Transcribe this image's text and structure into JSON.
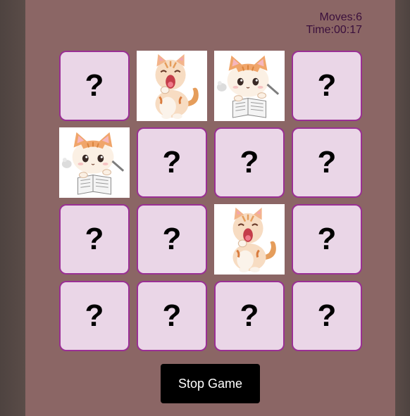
{
  "stats": {
    "moves": "Moves:6",
    "time": "Time:00:17"
  },
  "cards": [
    {
      "state": "hidden",
      "symbol": "?"
    },
    {
      "state": "revealed",
      "image": "yawning-kitten"
    },
    {
      "state": "revealed",
      "image": "studying-kitten"
    },
    {
      "state": "hidden",
      "symbol": "?"
    },
    {
      "state": "revealed",
      "image": "studying-kitten"
    },
    {
      "state": "hidden",
      "symbol": "?"
    },
    {
      "state": "hidden",
      "symbol": "?"
    },
    {
      "state": "hidden",
      "symbol": "?"
    },
    {
      "state": "hidden",
      "symbol": "?"
    },
    {
      "state": "hidden",
      "symbol": "?"
    },
    {
      "state": "revealed",
      "image": "yawning-kitten"
    },
    {
      "state": "hidden",
      "symbol": "?"
    },
    {
      "state": "hidden",
      "symbol": "?"
    },
    {
      "state": "hidden",
      "symbol": "?"
    },
    {
      "state": "hidden",
      "symbol": "?"
    },
    {
      "state": "hidden",
      "symbol": "?"
    }
  ],
  "controls": {
    "stop_label": "Stop Game"
  },
  "colors": {
    "panel": "#8b6665",
    "card_back": "#ead6e7",
    "card_border": "#9a2f94",
    "button": "#000000"
  }
}
